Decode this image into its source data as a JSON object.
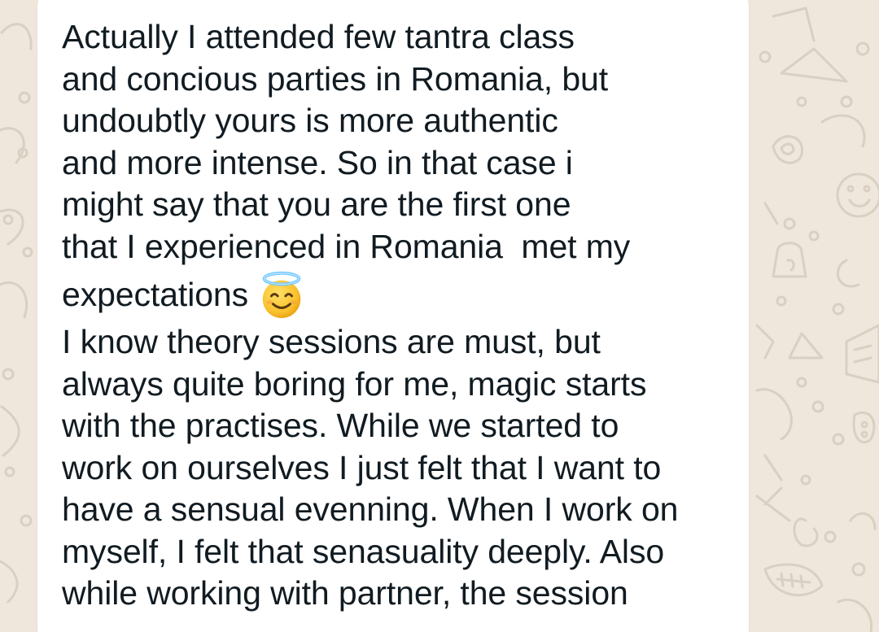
{
  "chat": {
    "message": {
      "lines": [
        "Actually I attended few tantra class",
        "and concious parties in Romania, but",
        "undoubtly yours is more authentic",
        "and more intense. So in that case i",
        "might say that you are the first one",
        "that I experienced in Romania  met my",
        "expectations",
        "I know theory sessions are must, but",
        "always quite boring for me, magic starts",
        "with the practises. While we started to",
        "work on ourselves I just felt that I want to",
        "have a sensual evenning. When I work on",
        "myself, I felt that senasuality deeply. Also",
        "while working with partner, the session"
      ],
      "emoji": "smiling-face-with-halo-emoji"
    },
    "colors": {
      "wallpaper": "#efe7dc",
      "doodle": "#d9cfc2",
      "bubble": "#ffffff",
      "text": "#111b21"
    }
  }
}
